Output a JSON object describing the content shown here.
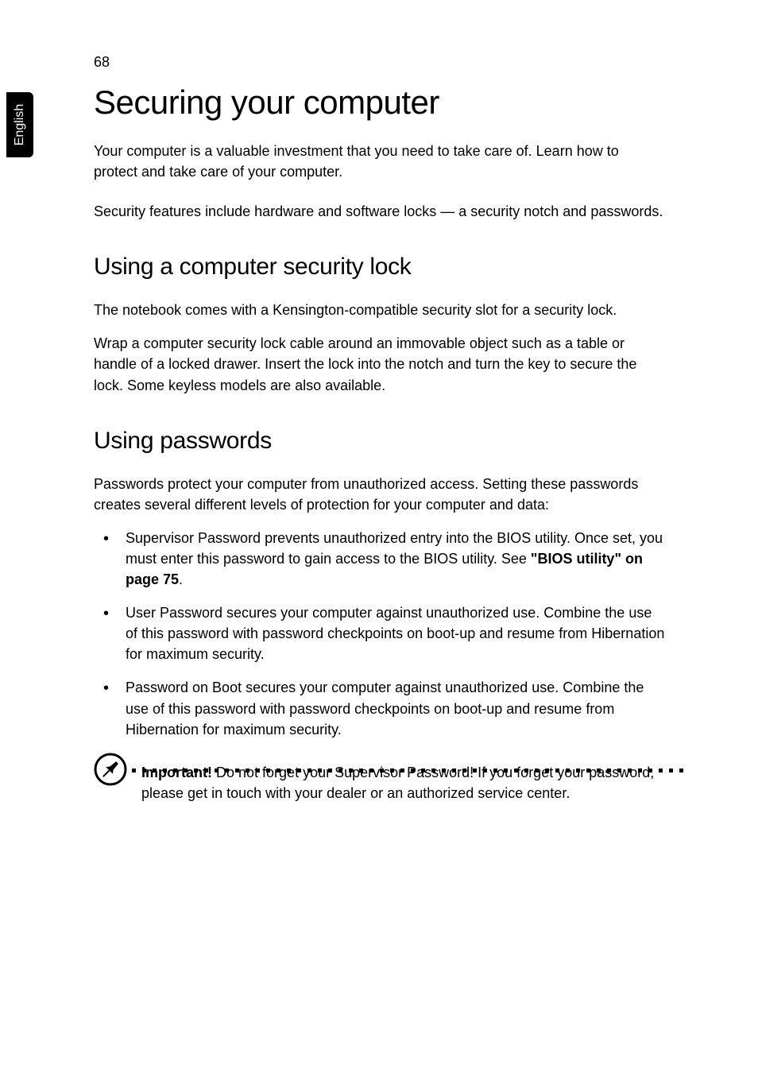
{
  "page": {
    "number": "68",
    "language": "English"
  },
  "heading": {
    "title": "Securing your computer"
  },
  "intro": {
    "p1": "Your computer is a valuable investment that you need to take care of. Learn how to protect and take care of your computer.",
    "p2": "Security features include hardware and software locks — a security notch and passwords."
  },
  "section1": {
    "heading": "Using a computer security lock",
    "p1": "The notebook comes with a Kensington-compatible security slot for a security lock.",
    "p2": "Wrap a computer security lock cable around an immovable object such as a table or handle of a locked drawer. Insert the lock into the notch and turn the key to secure the lock. Some keyless models are also available."
  },
  "section2": {
    "heading": "Using passwords",
    "intro": "Passwords protect your computer from unauthorized access. Setting these passwords creates several different levels of protection for your computer and data:",
    "bullets": {
      "b1_part1": "Supervisor Password prevents unauthorized entry into the BIOS utility. Once set, you must enter this password to gain access to the BIOS utility. See ",
      "b1_link": "\"BIOS utility\" on page 75",
      "b1_part2": ".",
      "b2": "User Password secures your computer against unauthorized use. Combine the use of this password with password checkpoints on boot-up and resume from Hibernation for maximum security.",
      "b3": "Password on Boot secures your computer against unauthorized use. Combine the use of this password with password checkpoints on boot-up and resume from Hibernation for maximum security."
    }
  },
  "important": {
    "label": "Important!",
    "text": " Do not forget your Supervisor Password! If you forget your password, please get in touch with your dealer or an authorized service center."
  }
}
